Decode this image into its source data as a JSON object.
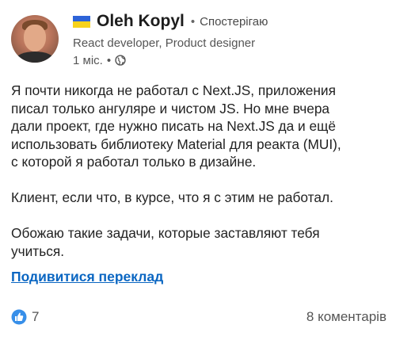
{
  "author": {
    "flag_icon": "ukraine-flag-icon",
    "name": "Oleh Kopyl",
    "separator": "•",
    "follow_status": "Спостерігаю",
    "headline": "React developer, Product designer",
    "time": "1 міс.",
    "time_separator": "•",
    "visibility_icon": "globe-icon"
  },
  "post": {
    "paragraphs": [
      [
        "Я почти никогда не работал с Next.JS, приложения",
        "писал только ангуляре и чистом JS. Но мне вчера",
        "дали проект, где нужно писать на Next.JS да и ещё",
        "использовать библиотеку Material для реакта (MUI),",
        "с которой я работал только в дизайне."
      ],
      [
        "Клиент, если что, в курсе, что я с этим не работал."
      ],
      [
        "Обожаю такие задачи, которые заставляют тебя",
        "учиться."
      ]
    ],
    "translate_link": "Подивитися переклад"
  },
  "social": {
    "reaction_icon": "like-icon",
    "reaction_count": "7",
    "comments": "8 коментарів",
    "colors": {
      "link": "#0a66c2",
      "like_blue": "#378fe9"
    }
  }
}
